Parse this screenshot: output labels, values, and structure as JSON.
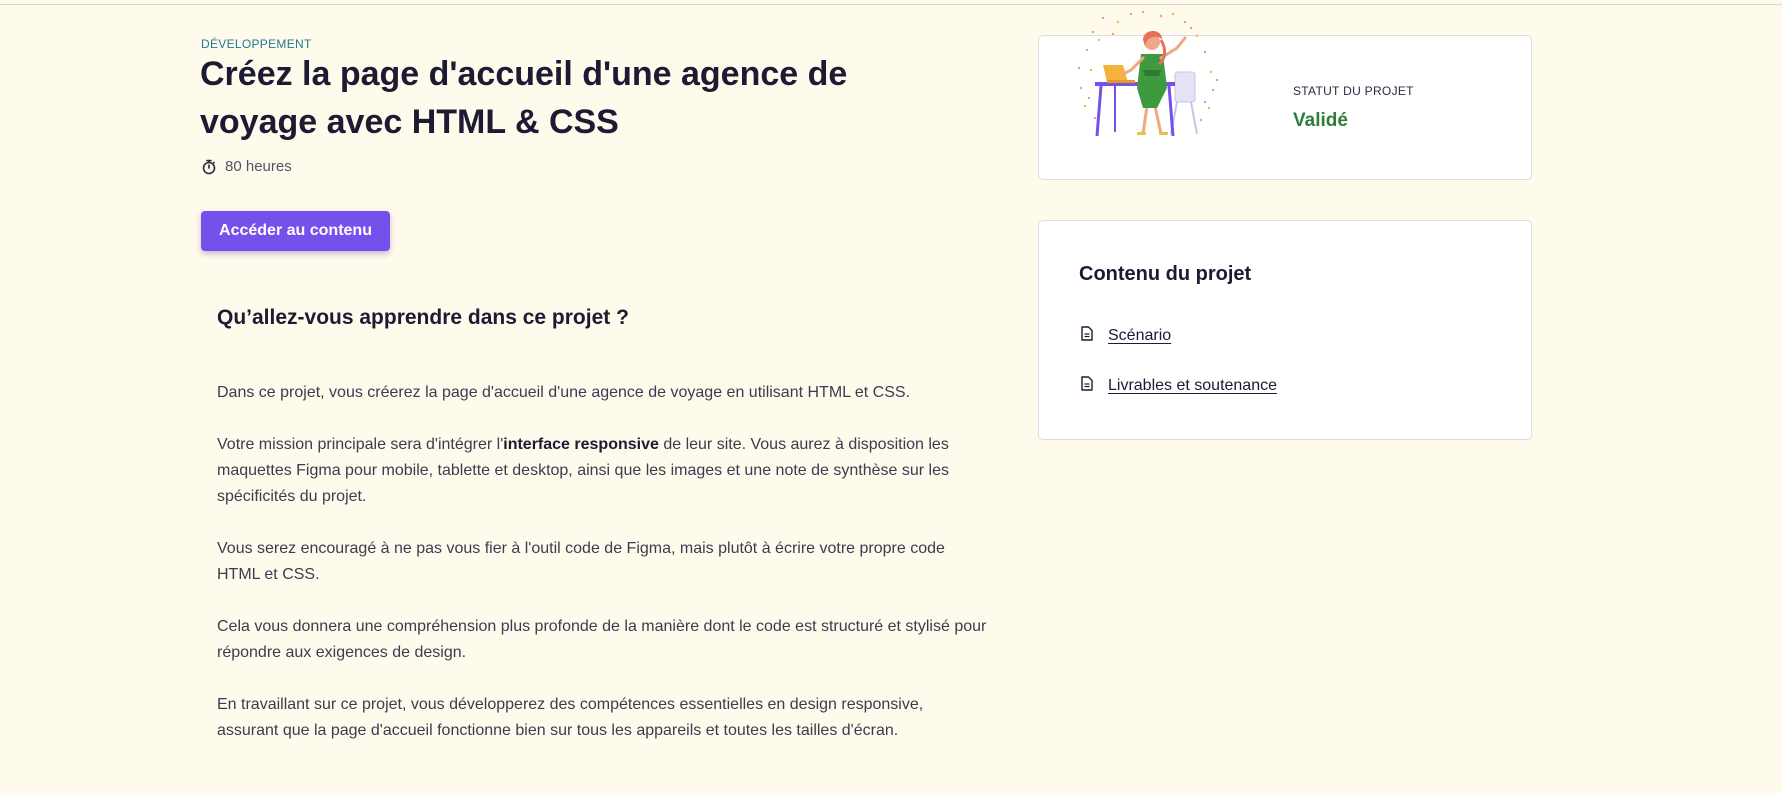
{
  "project": {
    "category": "Développement",
    "title": "Créez la page d'accueil d'une agence de voyage avec HTML & CSS",
    "duration": "80 heures",
    "cta_label": "Accéder au contenu"
  },
  "learn": {
    "heading": "Qu’allez-vous apprendre dans ce projet ?",
    "p1": "Dans ce projet, vous créerez la page d'accueil d'une agence de voyage en utilisant HTML et CSS.",
    "p2_before": "Votre mission principale sera d'intégrer l'",
    "p2_bold": "interface responsive",
    "p2_after": " de leur site. Vous aurez à disposition les maquettes Figma pour mobile, tablette et desktop, ainsi que les images et une note de synthèse sur les spécificités du projet.",
    "p3": "Vous serez encouragé à ne pas vous fier à l'outil code de Figma, mais plutôt à écrire votre propre code HTML et CSS.",
    "p4": "Cela vous donnera une compréhension plus profonde de la manière dont le code est structuré et stylisé pour répondre aux exigences de design.",
    "p5": "En travaillant sur ce projet, vous développerez des compétences essentielles en design responsive, assurant que la page d'accueil fonctionne bien sur tous les appareils et toutes les tailles d'écran."
  },
  "status": {
    "label": "Statut du projet",
    "value": "Validé",
    "value_color": "#2f7d3a"
  },
  "content": {
    "title": "Contenu du projet",
    "items": [
      {
        "label": "Scénario",
        "icon": "document-icon"
      },
      {
        "label": "Livrables et soutenance",
        "icon": "document-icon"
      }
    ]
  },
  "colors": {
    "accent": "#7451eb",
    "background": "#fefaec",
    "category": "#1f7a8c"
  },
  "icons": {
    "duration": "stopwatch-icon"
  }
}
